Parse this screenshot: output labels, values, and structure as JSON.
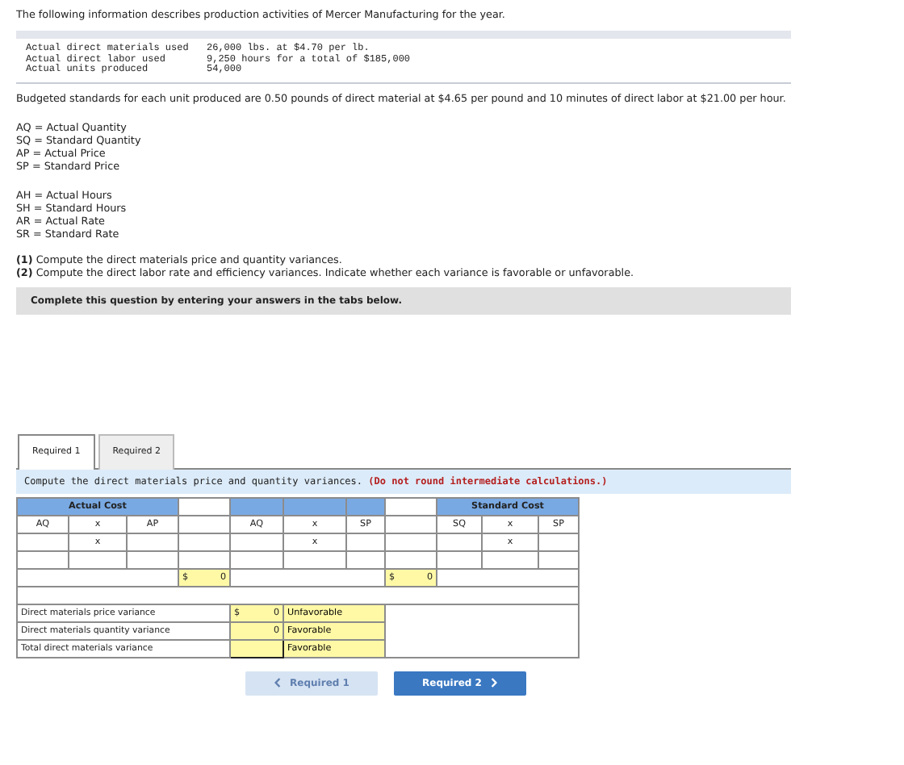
{
  "intro": "The following information describes production activities of Mercer Manufacturing for the year.",
  "facts": [
    {
      "label": "Actual direct materials used",
      "value": "26,000 lbs. at $4.70 per lb."
    },
    {
      "label": "Actual direct labor used",
      "value": "9,250 hours for a total of $185,000"
    },
    {
      "label": "Actual units produced",
      "value": "54,000"
    }
  ],
  "standards": "Budgeted standards for each unit produced are 0.50 pounds of direct material at $4.65 per pound and 10 minutes of direct labor at $21.00 per hour.",
  "definition_groups": [
    [
      "AQ = Actual Quantity",
      "SQ = Standard Quantity",
      "AP = Actual Price",
      "SP = Standard Price"
    ],
    [
      "AH = Actual Hours",
      "SH = Standard Hours",
      "AR = Actual Rate",
      "SR = Standard Rate"
    ]
  ],
  "tasks": [
    "**(1)** Compute the direct materials price and quantity variances.",
    "**(2)** Compute the direct labor rate and efficiency variances. Indicate whether each variance is favorable or unfavorable."
  ],
  "instruction": "Complete this question by entering your answers in the tabs below.",
  "tabs": [
    {
      "label": "Required 1",
      "selected": true
    },
    {
      "label": "Required 2",
      "selected": false
    }
  ],
  "prompt": {
    "text": "Compute the direct materials price and quantity variances.",
    "note": "(Do not round intermediate calculations.)"
  },
  "worksheet": {
    "groups": [
      {
        "title": "Actual Cost",
        "columns": [
          "AQ",
          "x",
          "AP"
        ],
        "operator": "x",
        "total_currency": "$",
        "total": "0"
      },
      {
        "columns": [
          "AQ",
          "x",
          "SP"
        ],
        "operator": "x",
        "total_currency": "$",
        "total": "0"
      },
      {
        "title": "Standard Cost",
        "columns": [
          "SQ",
          "x",
          "SP"
        ],
        "operator": "x"
      }
    ],
    "variances": [
      {
        "label": "Direct materials price variance",
        "currency": "$",
        "amount": "0",
        "result": "Unfavorable"
      },
      {
        "label": "Direct materials quantity variance",
        "amount": "0",
        "result": "Favorable"
      },
      {
        "label": "Total direct materials variance",
        "result": "Favorable"
      }
    ]
  },
  "buttons": [
    {
      "label": "Required 1",
      "kind": "prev",
      "disabled": true
    },
    {
      "label": "Required 2",
      "kind": "next",
      "disabled": false
    }
  ]
}
